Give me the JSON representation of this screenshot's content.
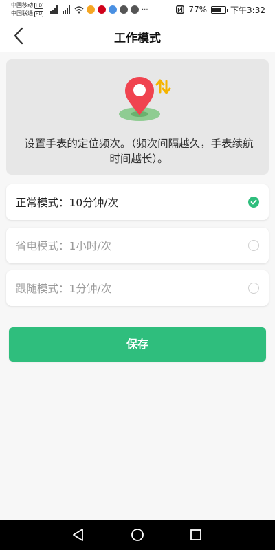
{
  "status_bar": {
    "carrier1": "中国移动",
    "carrier2": "中国联通",
    "hd_badge": "HD",
    "battery_text": "77%",
    "battery_level": 0.77,
    "time": "下午3:32"
  },
  "header": {
    "title": "工作模式",
    "back_icon": "chevron-left-icon"
  },
  "info": {
    "text": "设置手表的定位频次。（频次间隔越久，手表续航时间越长）。",
    "illustration_icon": "location-pin-icon"
  },
  "modes": [
    {
      "label": "正常模式：10分钟/次",
      "selected": true
    },
    {
      "label": "省电模式：1小时/次",
      "selected": false
    },
    {
      "label": "跟随模式：1分钟/次",
      "selected": false
    }
  ],
  "save_button": {
    "label": "保存"
  },
  "colors": {
    "accent": "#2fbe7d",
    "pin_red": "#f0434f",
    "card_bg": "#e7e7e7",
    "page_bg": "#f7f7f7"
  },
  "nav_bar": {
    "back": "triangle-back-icon",
    "home": "circle-home-icon",
    "recents": "square-recents-icon"
  }
}
